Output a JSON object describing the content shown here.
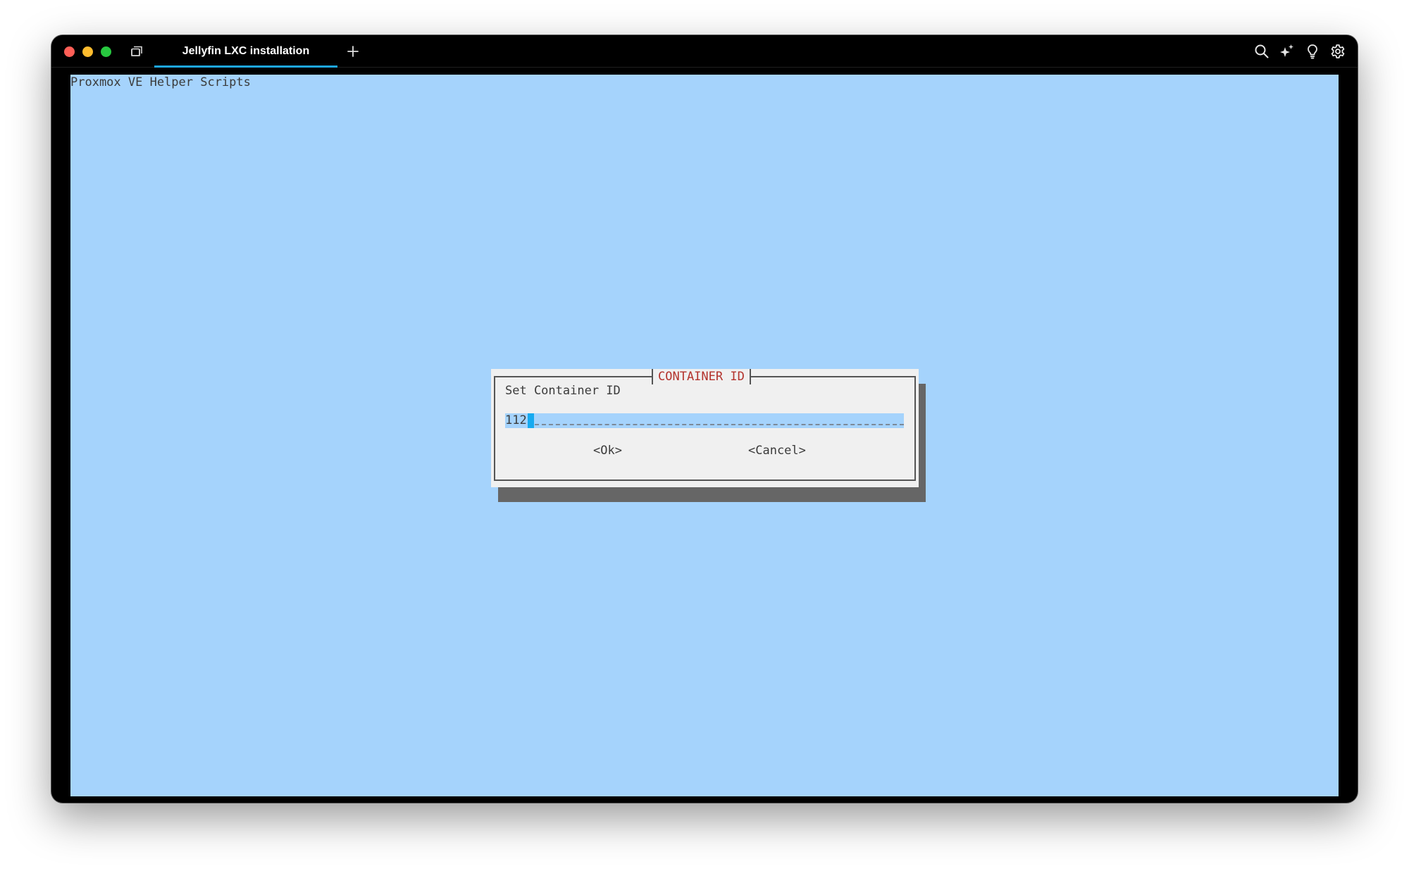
{
  "window": {
    "tab_title": "Jellyfin LXC installation"
  },
  "toolbar": {
    "icons": [
      "search-icon",
      "sparkle-icon",
      "lightbulb-icon",
      "gear-icon"
    ]
  },
  "terminal": {
    "backtitle": "Proxmox VE Helper Scripts",
    "dialog": {
      "title": "CONTAINER ID",
      "prompt": "Set Container ID",
      "input_value": "112",
      "ok_label": "<Ok>",
      "cancel_label": "<Cancel>"
    }
  },
  "colors": {
    "terminal_background": "#a5d3fc",
    "dialog_background": "#f0f0f0",
    "dialog_title": "#b3332d",
    "cursor": "#16aaf0",
    "tab_accent": "#1ea7e6"
  }
}
